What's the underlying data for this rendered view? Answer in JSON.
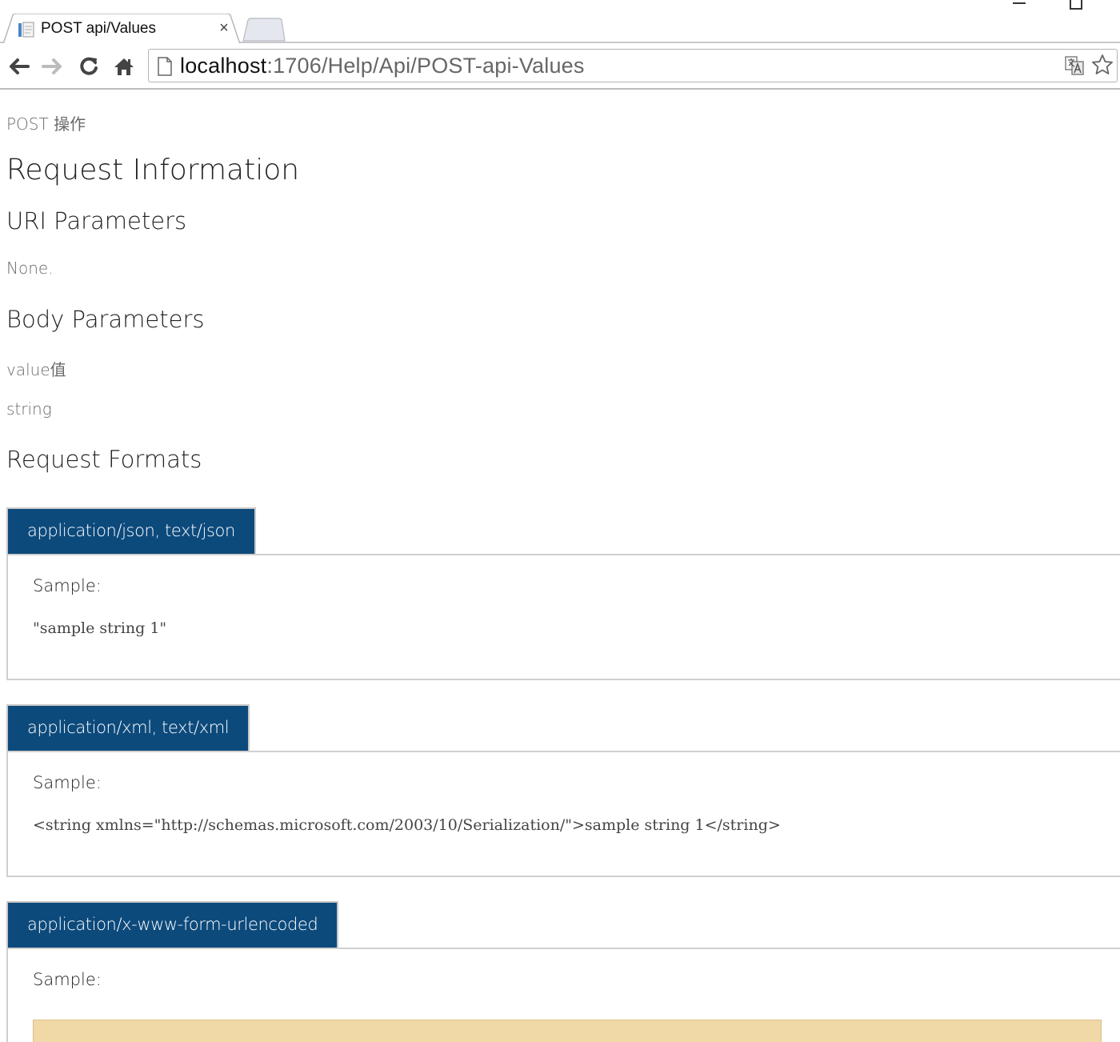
{
  "browser": {
    "tab_title": "POST api/Values",
    "tab_close": "×",
    "url_host": "localhost",
    "url_rest": ":1706/Help/Api/POST-api-Values"
  },
  "page": {
    "action_title": "POST 操作",
    "heading": "Request Information",
    "uri_parameters": {
      "heading": "URI Parameters",
      "text": "None."
    },
    "body_parameters": {
      "heading": "Body Parameters",
      "name": "value值",
      "type": "string"
    },
    "request_formats": {
      "heading": "Request Formats",
      "formats": [
        {
          "media_type": "application/json, text/json",
          "sample_label": "Sample:",
          "sample": "\"sample string 1\""
        },
        {
          "media_type": "application/xml, text/xml",
          "sample_label": "Sample:",
          "sample": "<string xmlns=\"http://schemas.microsoft.com/2003/10/Serialization/\">sample string 1</string>"
        },
        {
          "media_type": "application/x-www-form-urlencoded",
          "sample_label": "Sample:"
        }
      ]
    }
  },
  "colors": {
    "format_tab_bg": "#0d4a7c",
    "sample_box_bg": "#f0d9a6"
  }
}
